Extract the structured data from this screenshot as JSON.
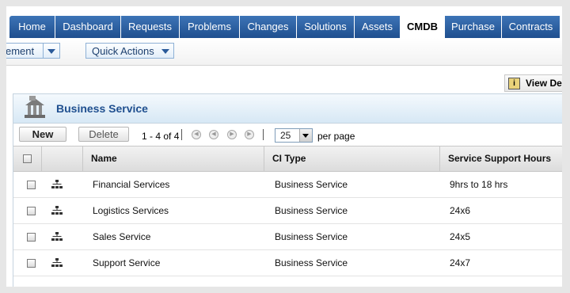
{
  "nav": {
    "tabs": [
      {
        "label": "Home"
      },
      {
        "label": "Dashboard"
      },
      {
        "label": "Requests"
      },
      {
        "label": "Problems"
      },
      {
        "label": "Changes"
      },
      {
        "label": "Solutions"
      },
      {
        "label": "Assets"
      },
      {
        "label": "CMDB"
      },
      {
        "label": "Purchase"
      },
      {
        "label": "Contracts"
      }
    ],
    "active": "CMDB"
  },
  "subbar": {
    "left_dropdown_label": "ement",
    "quick_actions_label": "Quick Actions"
  },
  "view_details": {
    "label": "View De",
    "icon": "info-icon"
  },
  "panel": {
    "title": "Business Service",
    "icon": "building-icon",
    "new_label": "New",
    "delete_label": "Delete",
    "range_text": "1 - 4 of 4",
    "per_page_value": "25",
    "per_page_label": "per page"
  },
  "table": {
    "headers": [
      "Name",
      "CI Type",
      "Service Support Hours"
    ],
    "rows": [
      {
        "name": "Financial Services",
        "type": "Business Service",
        "hours": "9hrs to 18 hrs"
      },
      {
        "name": "Logistics Services",
        "type": "Business Service",
        "hours": "24x6"
      },
      {
        "name": "Sales Service",
        "type": "Business Service",
        "hours": "24x5"
      },
      {
        "name": "Support Service",
        "type": "Business Service",
        "hours": "24x7"
      }
    ]
  }
}
